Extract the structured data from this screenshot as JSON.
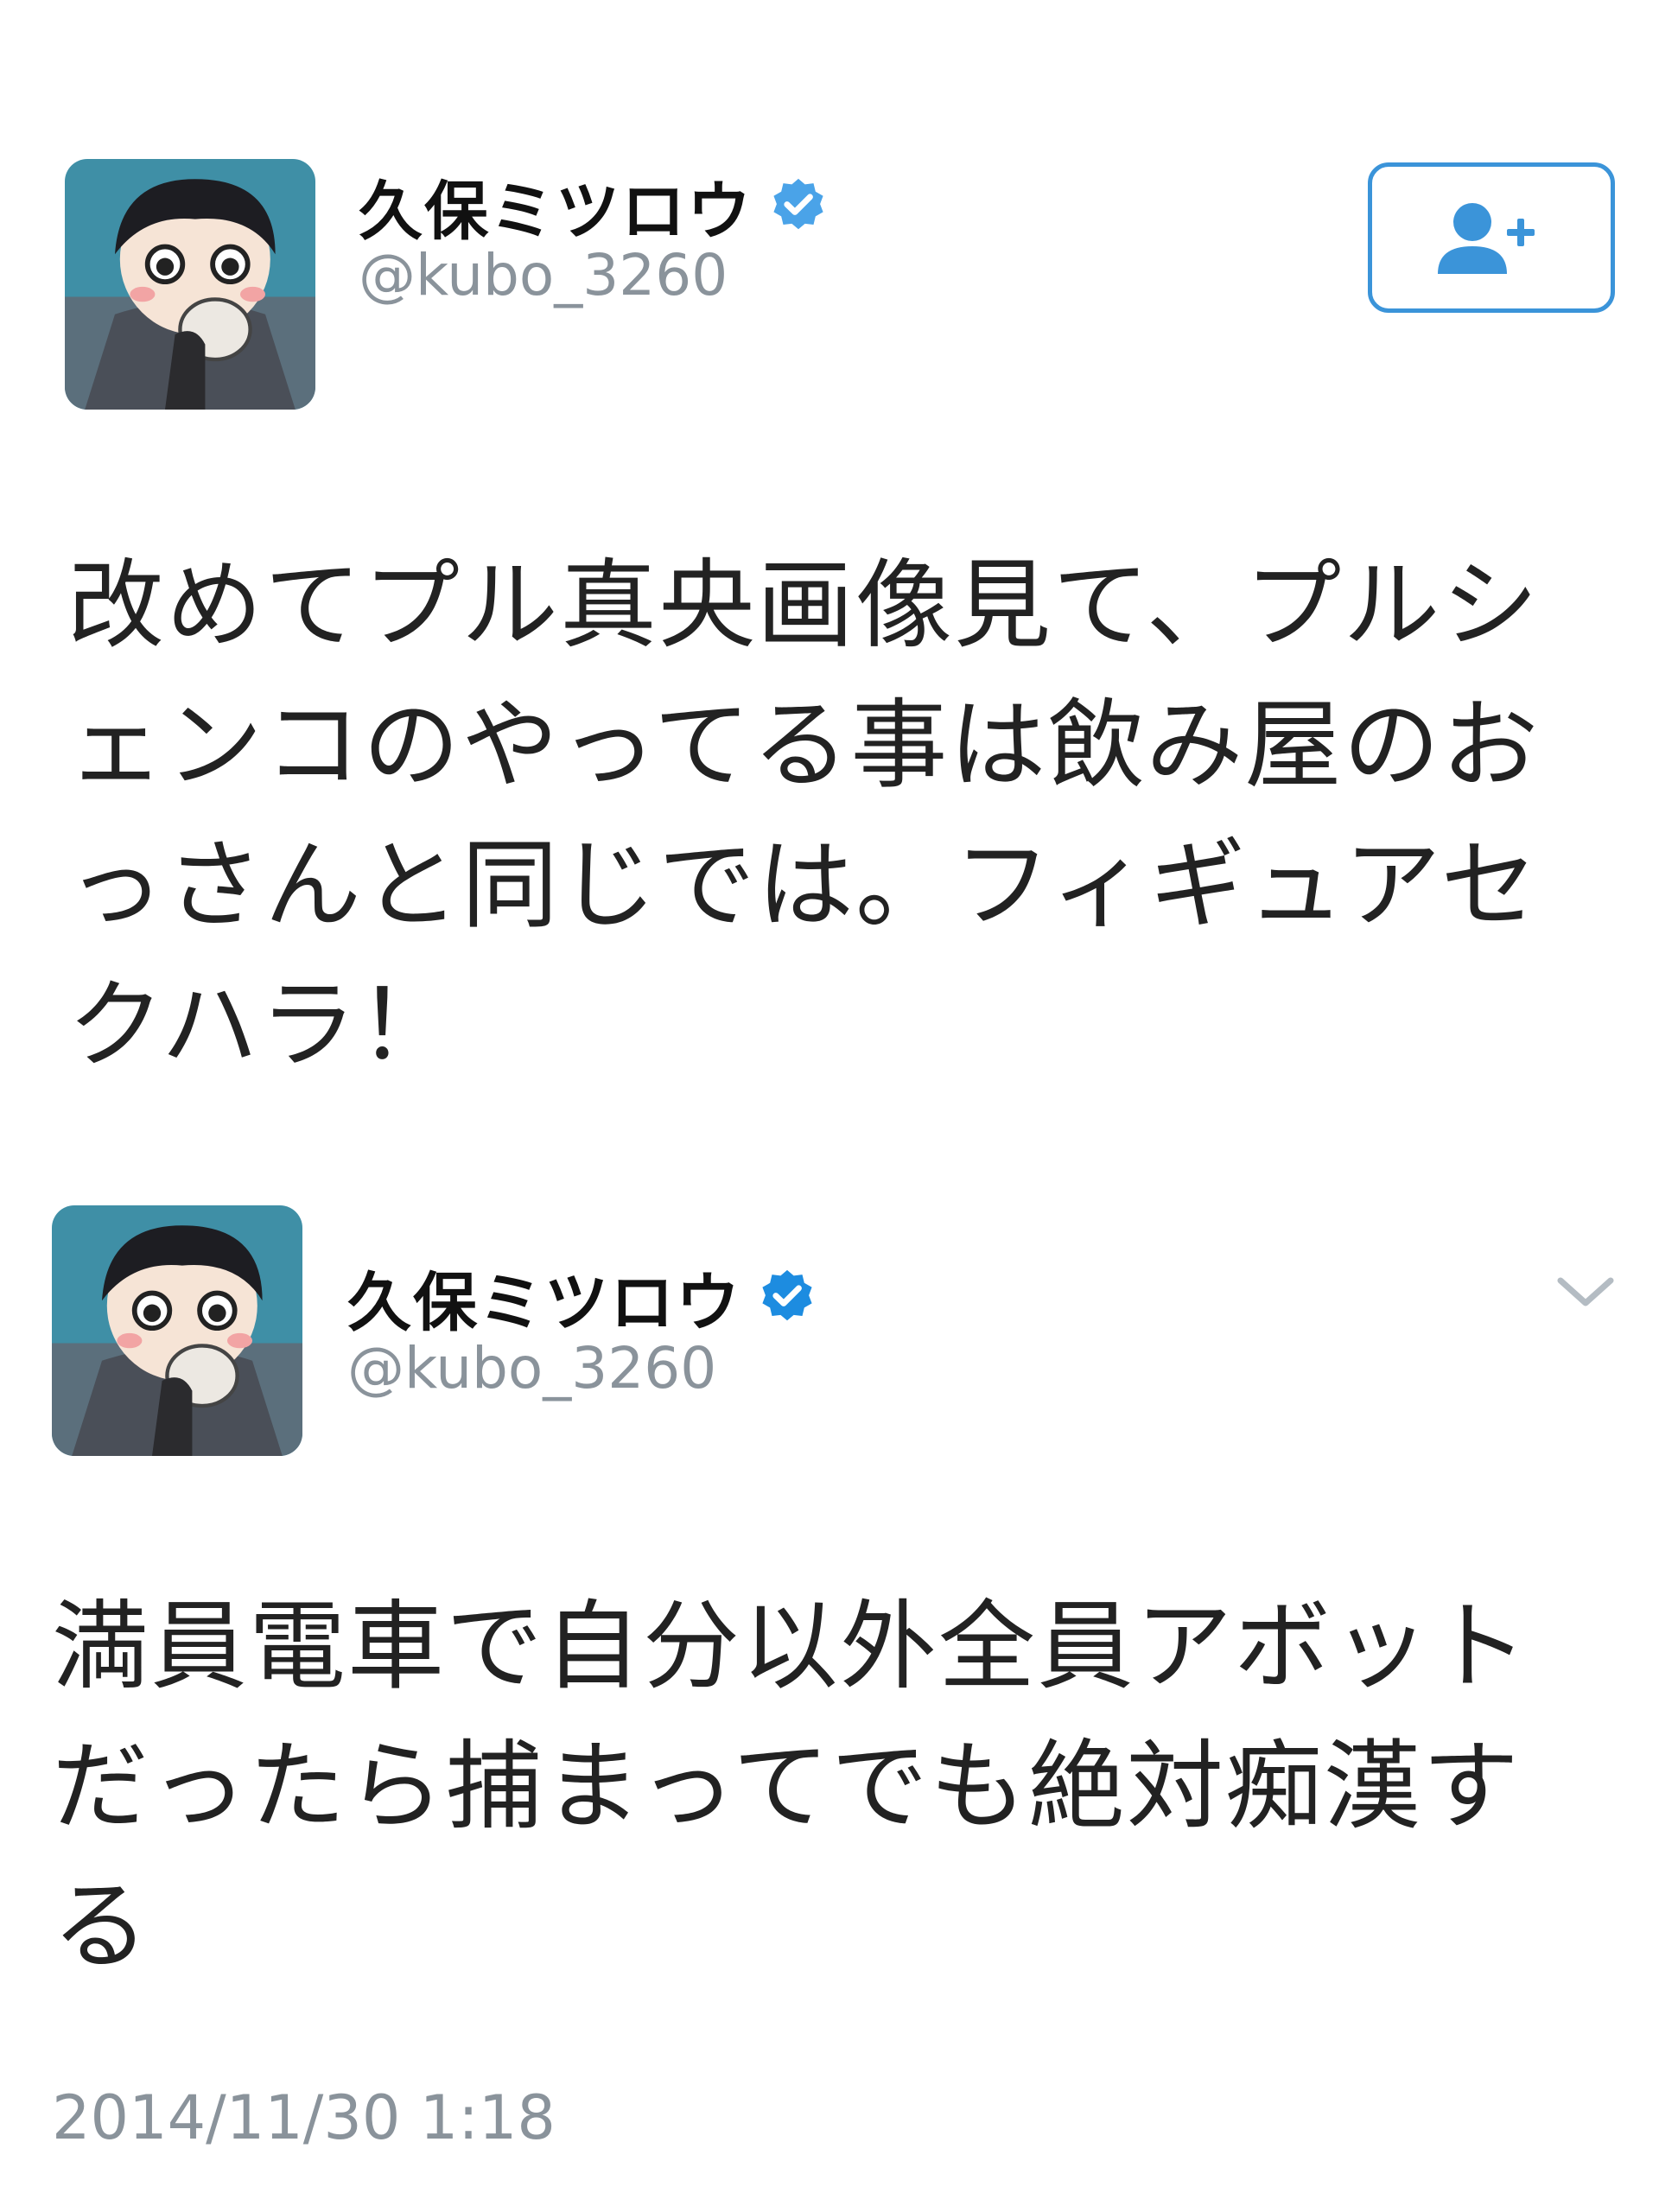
{
  "tweets": [
    {
      "display_name": "久保ミツロウ",
      "handle": "@kubo_3260",
      "text": "改めてプル真央画像見て、プルシェンコのやってる事は飲み屋のおっさんと同じでは。フィギュアセクハラ！"
    },
    {
      "display_name": "久保ミツロウ",
      "handle": "@kubo_3260",
      "text": "満員電車で自分以外全員アボットだったら捕まってでも絶対痴漢する",
      "timestamp": "2014/11/30 1:18"
    }
  ],
  "icons": {
    "verified": "verified-badge-icon",
    "follow": "follow-user-plus-icon",
    "more": "chevron-down-icon"
  },
  "colors": {
    "accent": "#3b94d9",
    "verified": "#4aa3e8",
    "muted_text": "#8a939b"
  }
}
